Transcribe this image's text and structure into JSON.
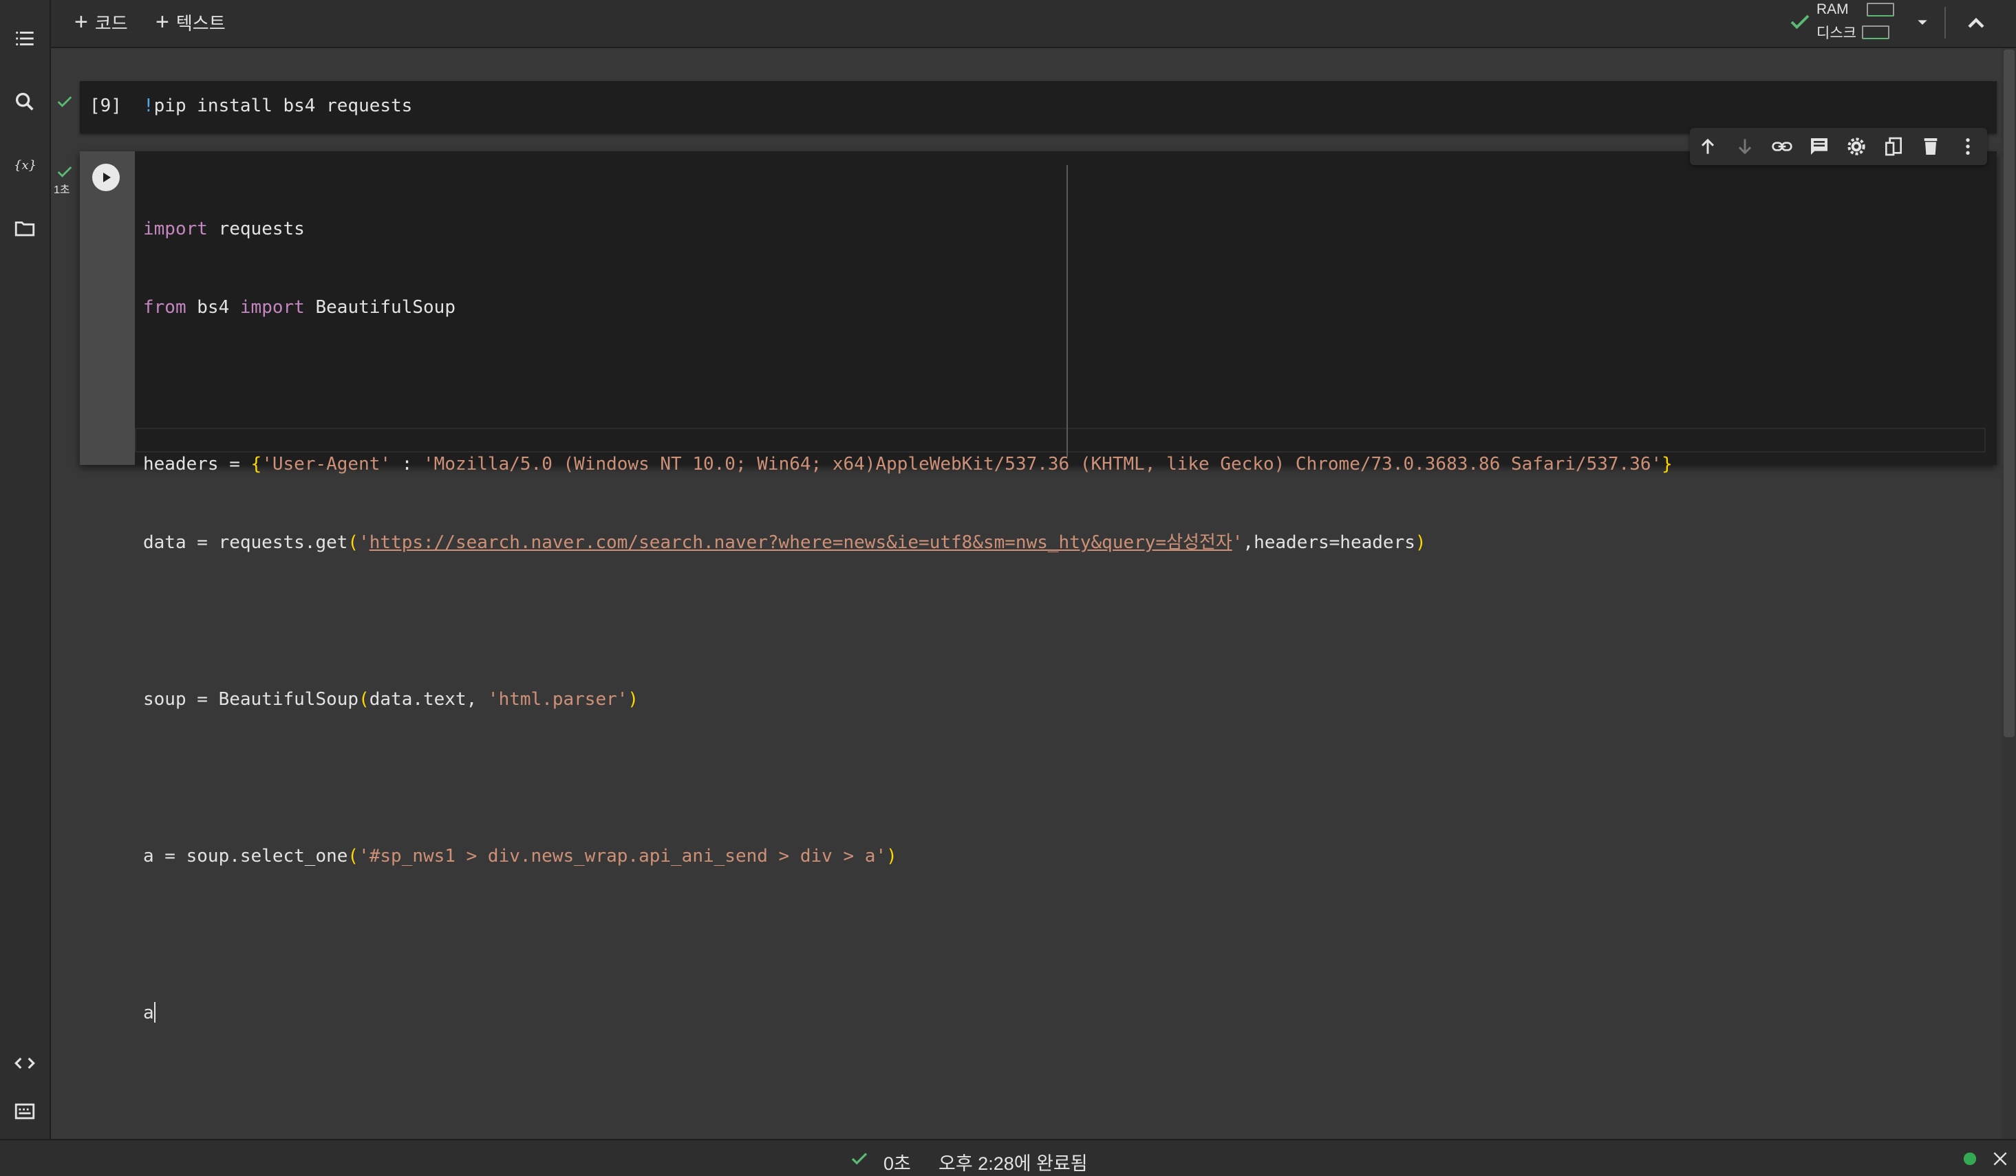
{
  "toolbar": {
    "add_code_label": "코드",
    "add_text_label": "텍스트",
    "ram_label": "RAM",
    "disk_label": "디스크"
  },
  "cell1": {
    "prompt": "[9]",
    "code_bang": "!",
    "code_rest": "pip install bs4 requests"
  },
  "cell2": {
    "exec_time": "1초",
    "code": {
      "l1": {
        "kw": "import",
        "rest": " requests"
      },
      "l2": {
        "kw1": "from",
        "mid": " bs4 ",
        "kw2": "import",
        "rest": " BeautifulSoup"
      },
      "l4": {
        "pre": "headers = ",
        "key": "'User-Agent'",
        "sep": " : ",
        "val": "'Mozilla/5.0 (Windows NT 10.0; Win64; x64)AppleWebKit/537.36 (KHTML, like Gecko) Chrome/73.0.3683.86 Safari/537.36'"
      },
      "l5": {
        "pre": "data = requests.get",
        "url": "https://search.naver.com/search.naver?where=news&ie=utf8&sm=nws_hty&query=삼성전자",
        "post": ",headers=headers"
      },
      "l7": {
        "pre": "soup = BeautifulSoup",
        "mid": "data.text, ",
        "str": "'html.parser'"
      },
      "l9": {
        "pre": "a = soup.select_one",
        "str": "'#sp_nws1 > div.news_wrap.api_ani_send > div > a'"
      },
      "l11": "a"
    }
  },
  "status": {
    "duration": "0초",
    "completed": "오후 2:28에 완료됨"
  },
  "colors": {
    "background": "#383838",
    "cell_bg": "#1e1e1e",
    "keyword": "#c586c0",
    "string": "#ce9178",
    "bracket": "#ffd700",
    "success": "#5bb974"
  },
  "icons": [
    "toc-icon",
    "search-icon",
    "variables-icon",
    "folder-icon",
    "code-snippets-icon",
    "terminal-icon",
    "check-icon",
    "dropdown-icon",
    "collapse-icon",
    "run-icon",
    "move-up-icon",
    "move-down-icon",
    "link-icon",
    "comment-icon",
    "settings-icon",
    "mirror-cell-icon",
    "delete-icon",
    "more-icon",
    "close-icon",
    "status-dot-icon"
  ]
}
